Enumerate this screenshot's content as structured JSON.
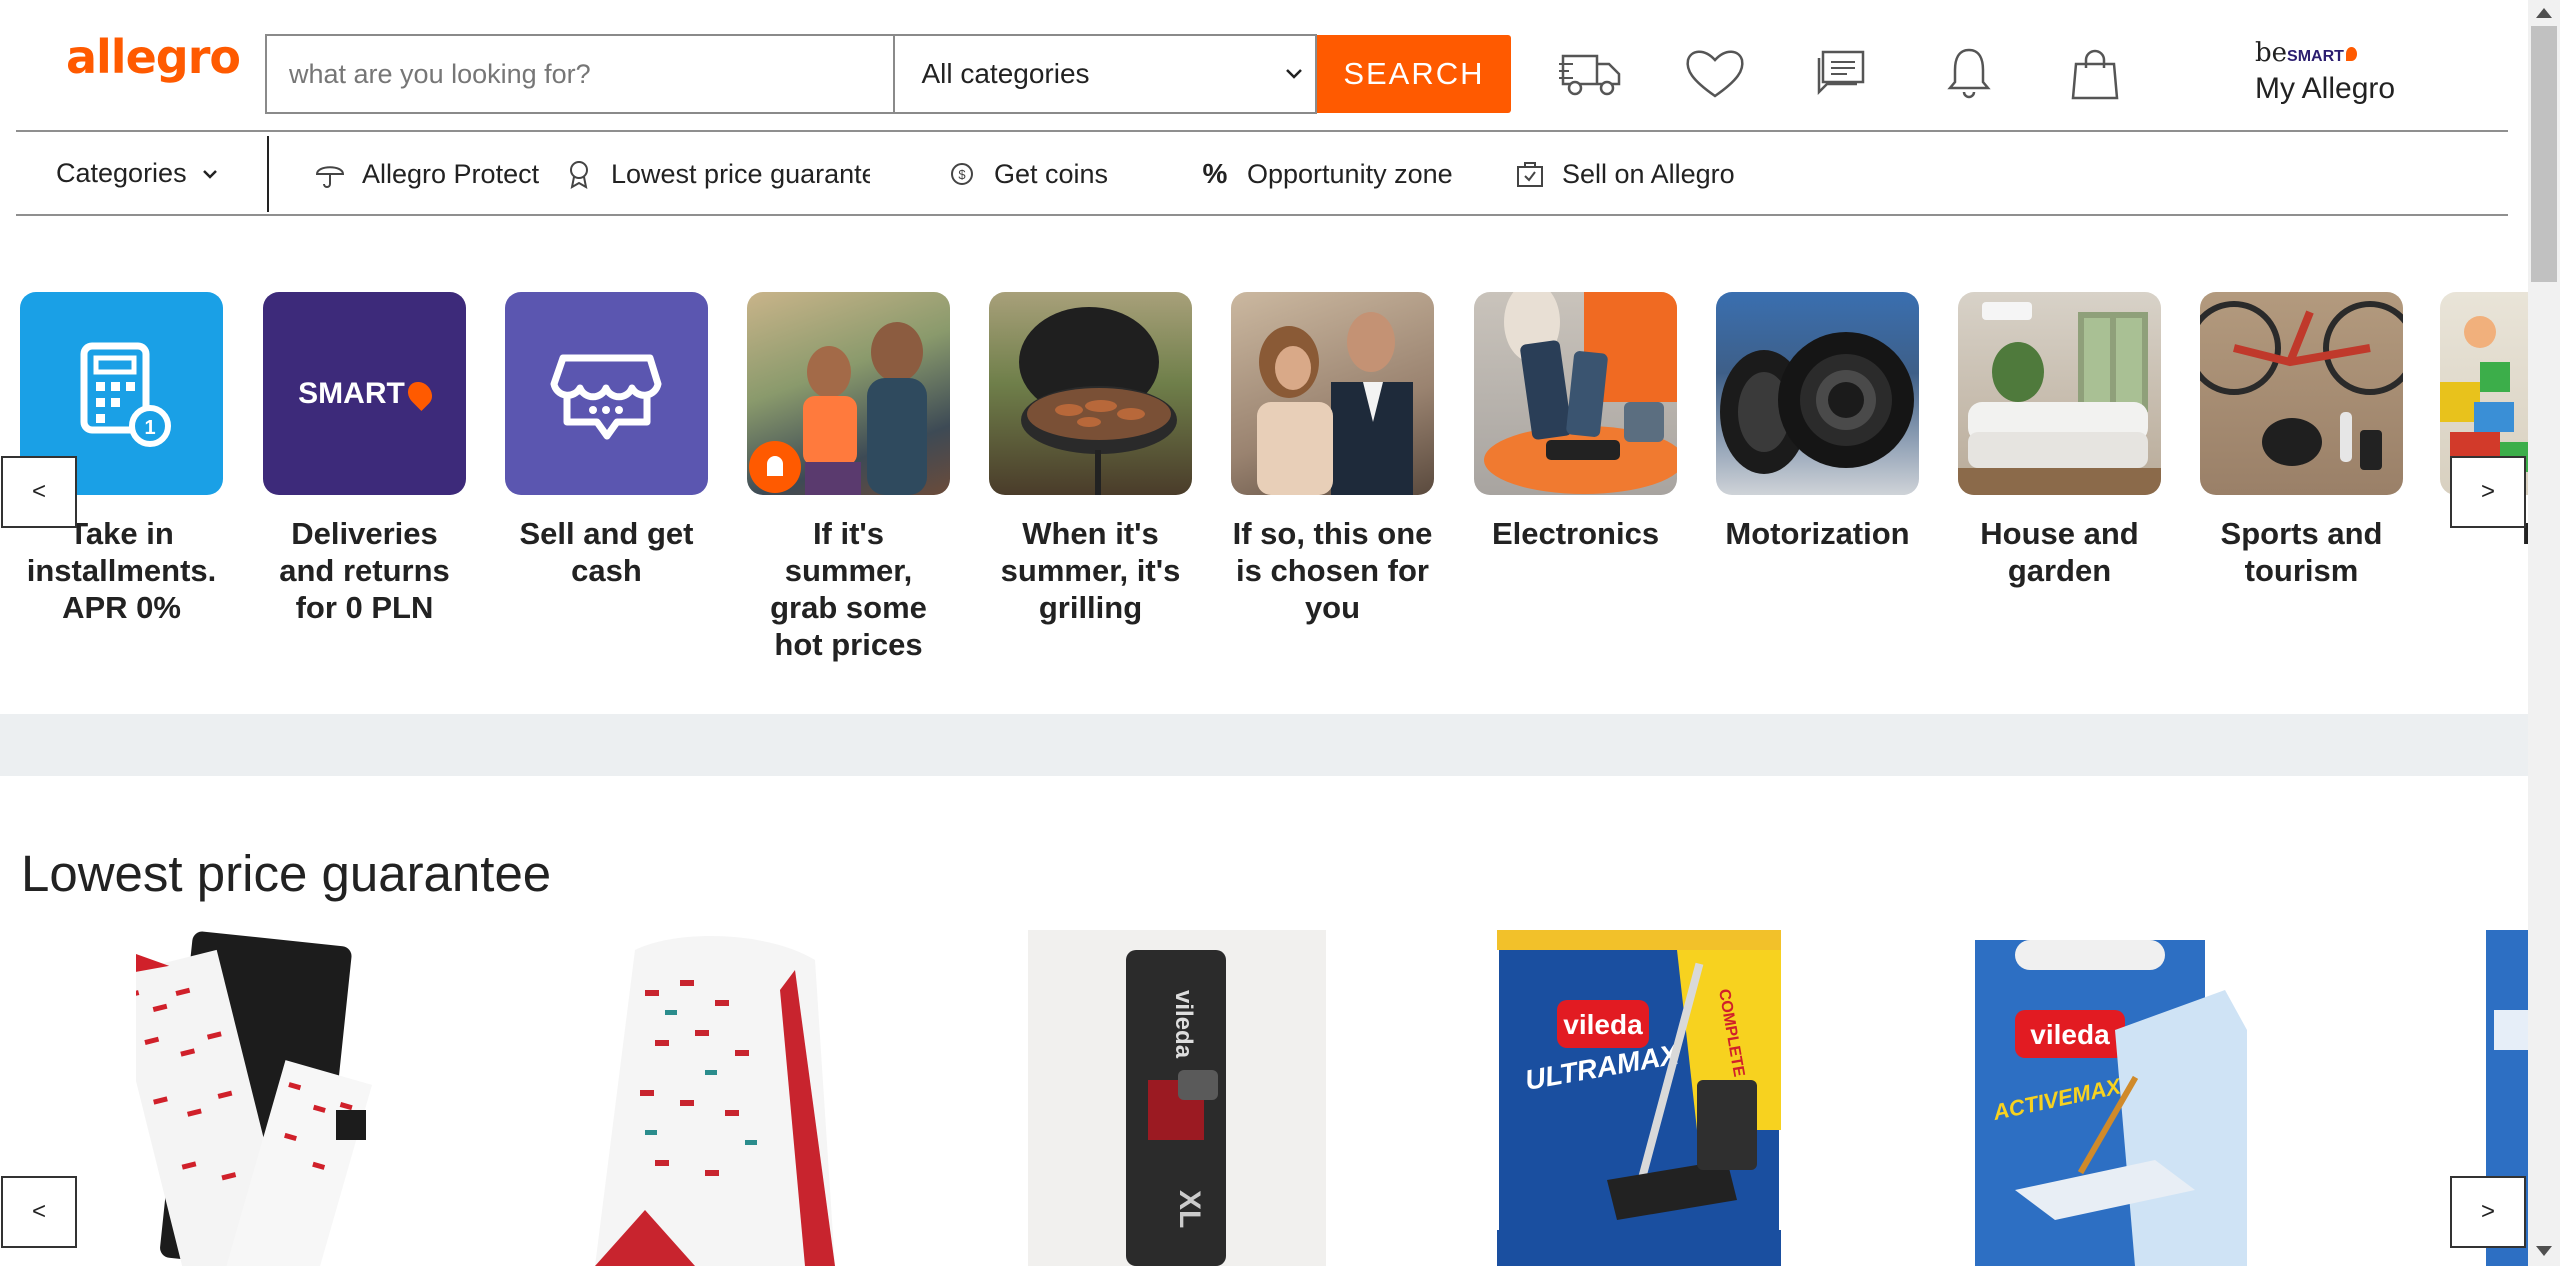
{
  "header": {
    "logo": "allegro",
    "search_placeholder": "what are you looking for?",
    "category_select": "All categories",
    "search_button": "SEARCH",
    "besmart_be": "be",
    "besmart_smart": "SMART",
    "my_allegro": "My Allegro"
  },
  "nav": {
    "categories": "Categories",
    "items": [
      {
        "label": "Allegro Protect",
        "icon": "umbrella-icon"
      },
      {
        "label": "Lowest price guarantee",
        "icon": "medal-icon"
      },
      {
        "label": "Get coins",
        "icon": "coin-icon"
      },
      {
        "label": "Opportunity zone",
        "icon": "percent-icon"
      },
      {
        "label": "Sell on Allegro",
        "icon": "sell-icon"
      }
    ]
  },
  "tiles": [
    {
      "label": "Take in installments. APR 0%",
      "kind": "calculator"
    },
    {
      "label": "Deliveries and returns for 0 PLN",
      "kind": "smart",
      "badge": "SMART"
    },
    {
      "label": "Sell and get cash",
      "kind": "shop"
    },
    {
      "label": "If it's summer, grab some hot prices",
      "kind": "photo"
    },
    {
      "label": "When it's summer, it's grilling",
      "kind": "photo"
    },
    {
      "label": "If so, this one is chosen for you",
      "kind": "photo"
    },
    {
      "label": "Electronics",
      "kind": "photo"
    },
    {
      "label": "Motorization",
      "kind": "photo"
    },
    {
      "label": "House and garden",
      "kind": "photo"
    },
    {
      "label": "Sports and tourism",
      "kind": "photo"
    },
    {
      "label": "K",
      "kind": "photo"
    }
  ],
  "carousel": {
    "prev": "<",
    "next": ">"
  },
  "section": {
    "title": "Lowest price guarantee"
  },
  "products": [
    {
      "brand": ""
    },
    {
      "brand": ""
    },
    {
      "brand": "vileda",
      "text": "XL"
    },
    {
      "brand": "vileda",
      "text": "ULTRAMAX",
      "badge": "COMPLETE SET"
    },
    {
      "brand": "vileda",
      "text": "ACTIVEMAX"
    },
    {
      "brand": ""
    }
  ],
  "colors": {
    "accent": "#ff5a00",
    "smart": "#3d2a7a",
    "blue": "#1aa0e6",
    "purple": "#5b56b0"
  }
}
